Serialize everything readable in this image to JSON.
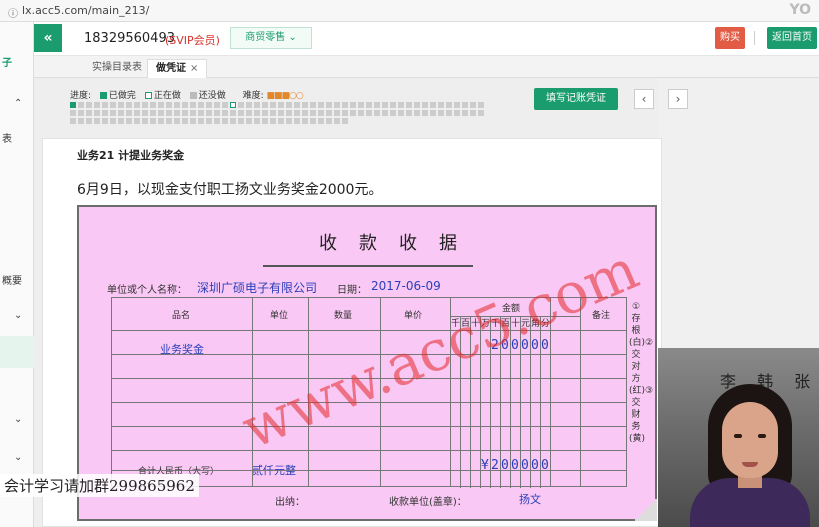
{
  "browser": {
    "url": "lx.acc5.com/main_213/",
    "corner_mark": "YO"
  },
  "sidebar": {
    "items": [
      "子",
      "表",
      "概要"
    ]
  },
  "header": {
    "account": "18329560493",
    "member_badge": "(SVIP会员)",
    "industry_select": "商贸零售",
    "buy_label": "购买",
    "home_label": "返回首页"
  },
  "tabs": [
    {
      "label": "实操目录表"
    },
    {
      "label": "做凭证",
      "close": "×"
    }
  ],
  "progress": {
    "label": "进度:",
    "done": "已做完",
    "doing": "正在做",
    "todo": "还没做",
    "difficulty_label": "难度:",
    "difficulty_stars": 3,
    "difficulty_max": 5
  },
  "actions": {
    "fill_voucher": "填写记账凭证",
    "prev": "‹",
    "next": "›"
  },
  "business": {
    "title": "业务21 计提业务奖金",
    "description": "6月9日，以现金支付职工扬文业务奖金2000元。"
  },
  "receipt": {
    "title": "收款收据",
    "unit_label": "单位或个人名称：",
    "unit_value": "深圳广硕电子有限公司",
    "date_label": "日期：",
    "date_value": "2017-06-09",
    "headers": {
      "item": "品名",
      "unit": "单位",
      "qty": "数量",
      "price": "单价",
      "amount": "金额",
      "note": "备注"
    },
    "digit_headers": [
      "千",
      "百",
      "十",
      "万",
      "千",
      "百",
      "十",
      "元",
      "角",
      "分"
    ],
    "row1_item": "业务奖金",
    "row1_digits": [
      "2",
      "0",
      "0",
      "0",
      "0",
      "0"
    ],
    "total_label": "合计人民币（大写）",
    "total_upper": "贰仟元整",
    "total_digits": [
      "¥",
      "2",
      "0",
      "0",
      "0",
      "0",
      "0"
    ],
    "cashier_label": "出纳：",
    "seal_label": "收款单位(盖章)：",
    "payee": "扬文",
    "side_note": "①存根(白)②交对方(红)③交财务(黄)",
    "watermark": "www.acc5.com"
  },
  "overlay": {
    "qq_group": "会计学习请加群299865962"
  },
  "webcam": {
    "calligraphy": "李 韩 张"
  }
}
